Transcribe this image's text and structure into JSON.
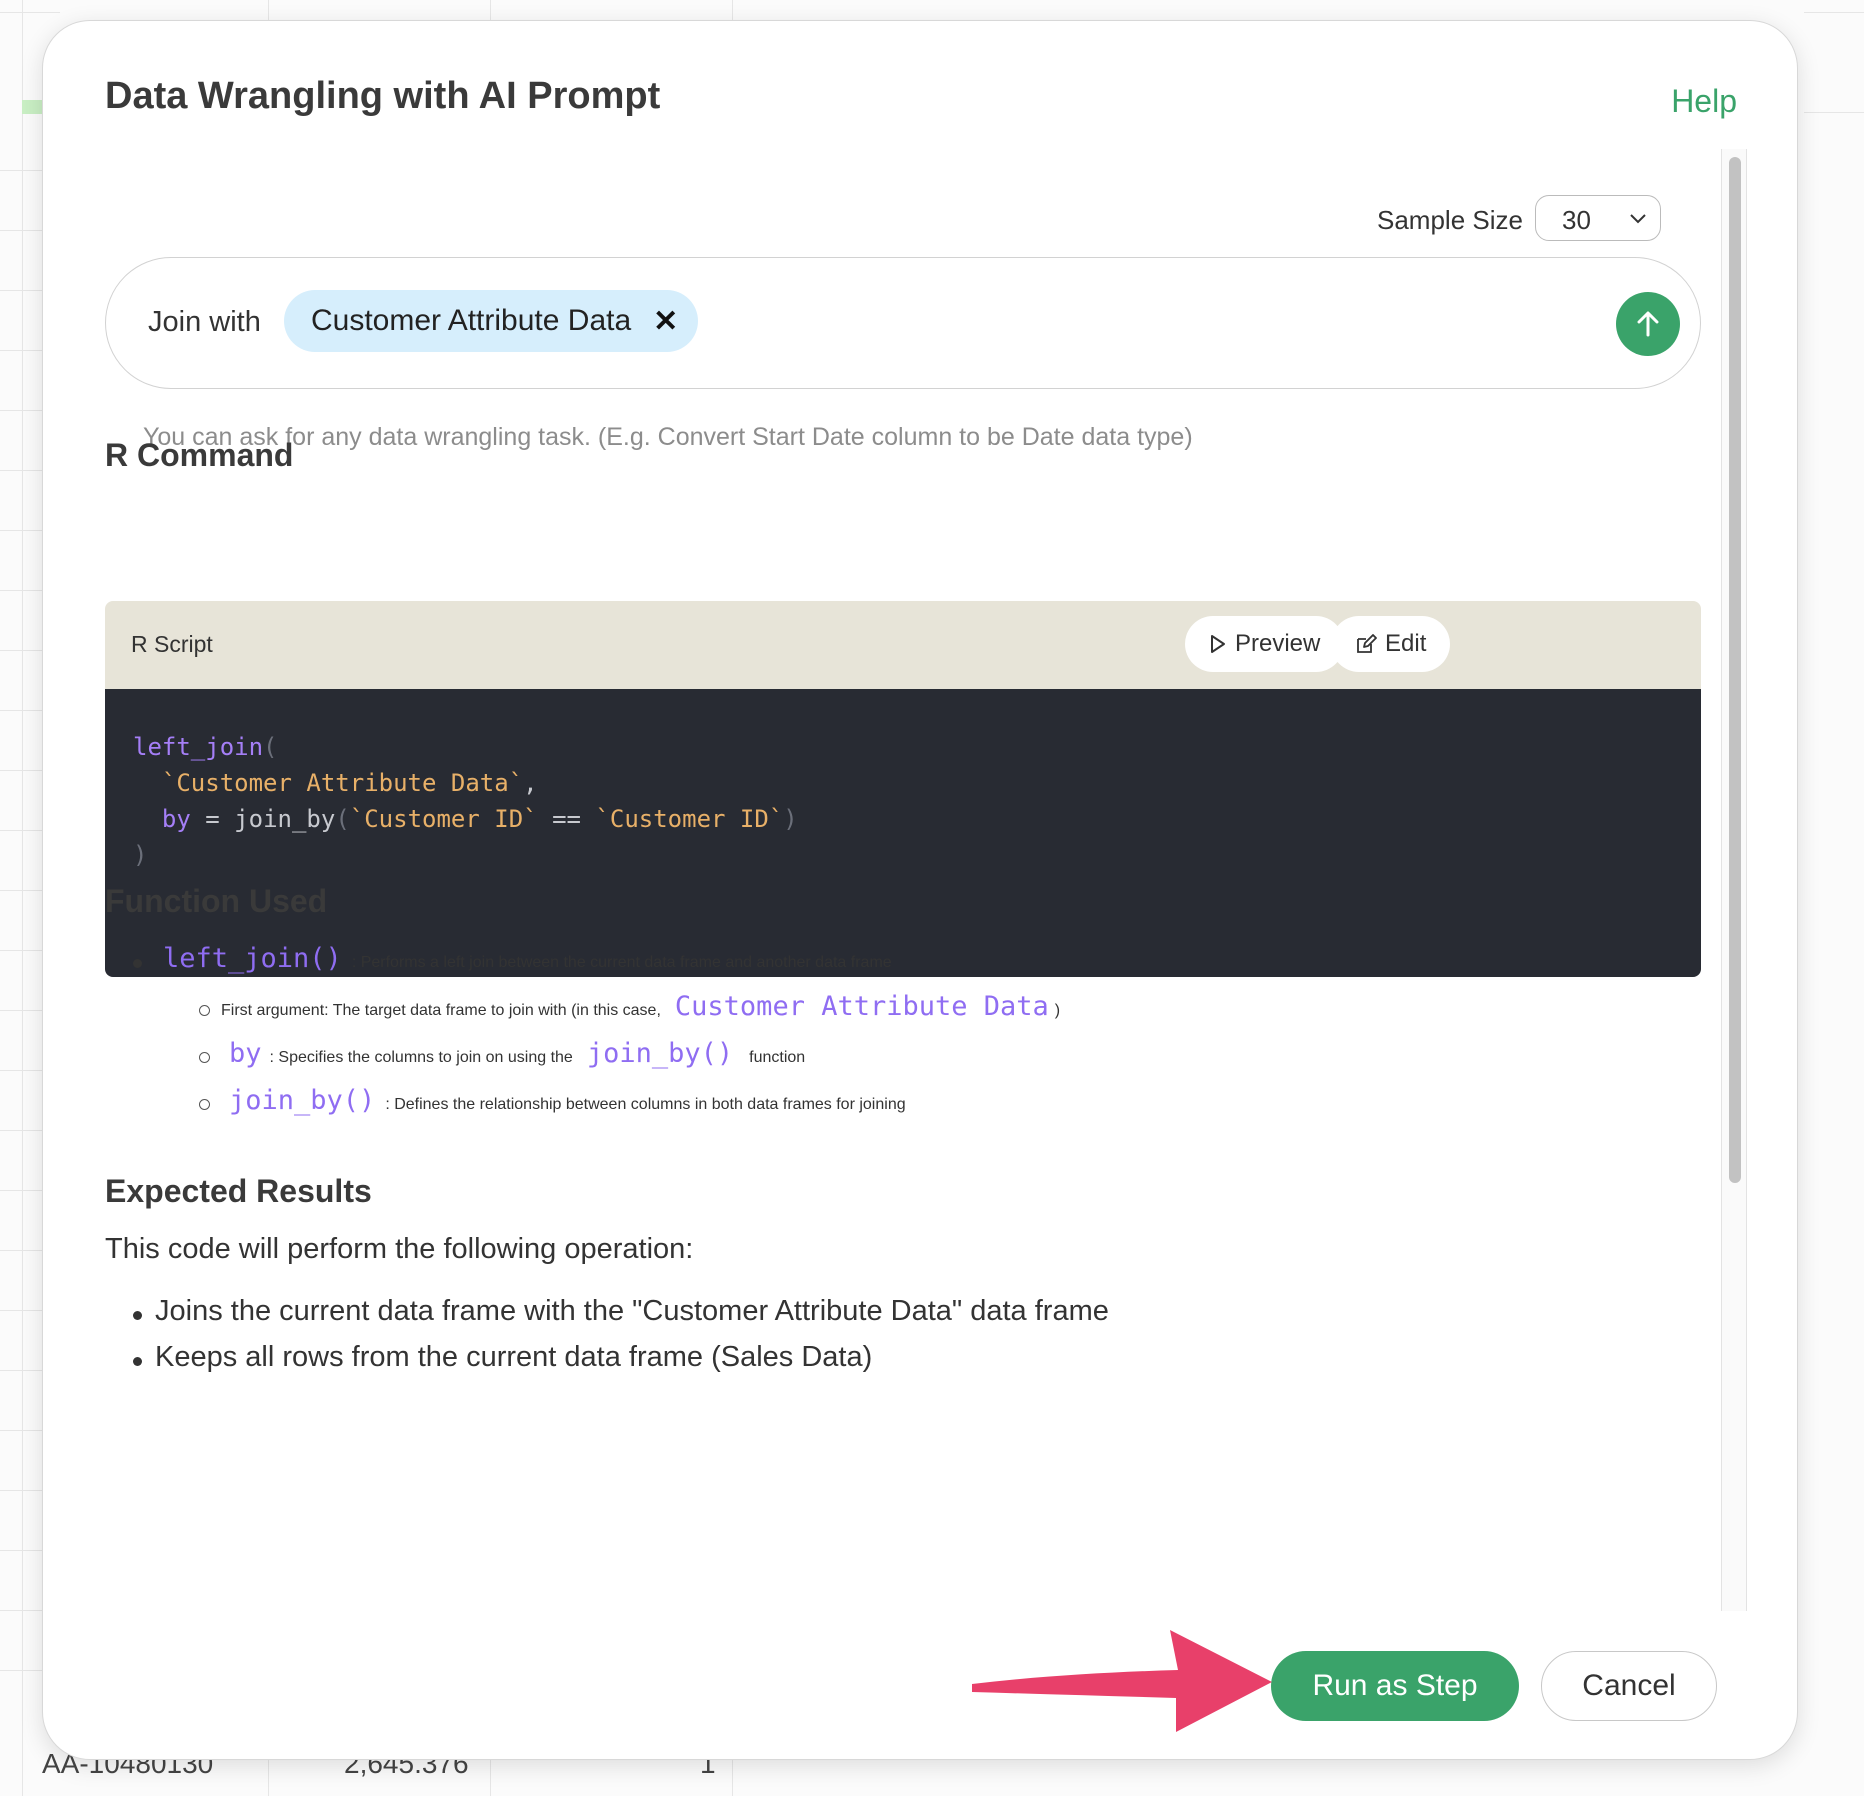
{
  "background": {
    "cell_id": "AA-10480130",
    "cell_value": "2,645.376",
    "cell_count": "1"
  },
  "dialog": {
    "title": "Data Wrangling with AI Prompt",
    "help_label": "Help"
  },
  "sample": {
    "label": "Sample Size",
    "value": "30"
  },
  "prompt": {
    "text": "Join with",
    "chip_label": "Customer Attribute Data",
    "hint": "You can ask for any data wrangling task. (E.g. Convert Start Date column to be Date data type)"
  },
  "r_command": {
    "heading": "R Command",
    "card_label": "R Script",
    "preview_label": "Preview",
    "edit_label": "Edit",
    "code": {
      "fn": "left_join",
      "open_paren": "(",
      "arg1": "`Customer Attribute Data`",
      "comma": ",",
      "by_kw": "by",
      "eq": " = ",
      "join_fn": "join_by",
      "arg_a": "`Customer ID`",
      "op": " == ",
      "arg_b": "`Customer ID`",
      "close_paren": ")"
    }
  },
  "function_used": {
    "heading": "Function Used",
    "main_code": "left_join()",
    "main_text": ": Performs a left join between the current data frame and another data frame",
    "sub1_text": "First argument: The target data frame to join with (in this case,",
    "sub1_code": "Customer Attribute Data",
    "sub1_end": ")",
    "sub2_code": "by",
    "sub2_text": ": Specifies the columns to join on using the",
    "sub2_code2": "join_by()",
    "sub2_end": "function",
    "sub3_code": "join_by()",
    "sub3_text": ": Defines the relationship between columns in both data frames for joining"
  },
  "expected": {
    "heading": "Expected Results",
    "intro": "This code will perform the following operation:",
    "items": [
      "Joins the current data frame with the \"Customer Attribute Data\" data frame",
      "Keeps all rows from the current data frame (Sales Data)"
    ]
  },
  "footer": {
    "run_label": "Run as Step",
    "cancel_label": "Cancel"
  },
  "colors": {
    "accent": "#3aa36a",
    "chip_bg": "#d6eefc",
    "code_bg": "#282b33",
    "code_header_bg": "#e7e4d8",
    "arrow": "#e8406a"
  }
}
